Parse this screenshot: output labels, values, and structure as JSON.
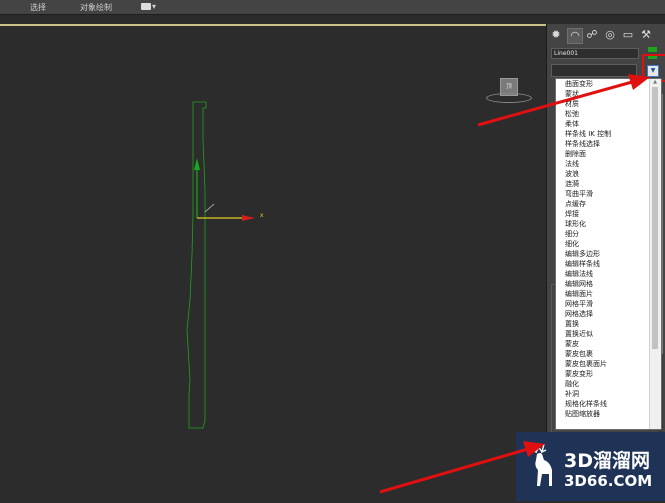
{
  "menubar": {
    "items": [
      "选择",
      "对象绘制"
    ],
    "dropdown_arrow": "▾"
  },
  "viewport": {
    "viewcube_face": "顶",
    "axis_x_label": "x"
  },
  "command_panel": {
    "tabs": [
      "create-icon",
      "modify-icon",
      "hierarchy-icon",
      "motion-icon",
      "display-icon",
      "utilities-icon"
    ],
    "tab_glyphs": [
      "✹",
      "◠",
      "☍",
      "◎",
      "▭",
      "⚒"
    ],
    "object_name": "Line001",
    "object_color": "#1ea51e",
    "dropdown_button_glyph": "▼"
  },
  "modifier_list": {
    "items": [
      "曲面变形",
      "蒙状",
      "材质",
      "松弛",
      "柔体",
      "样条线 IK 控制",
      "样条线选择",
      "删除面",
      "法线",
      "波浪",
      "涟漪",
      "弯曲平滑",
      "点缓存",
      "焊接",
      "球形化",
      "细分",
      "细化",
      "编辑多边形",
      "编辑样条线",
      "编辑法线",
      "编辑网格",
      "编辑面片",
      "网格平滑",
      "网格选择",
      "置换",
      "置换近似",
      "蒙皮",
      "蒙皮包裹",
      "蒙皮包裹面片",
      "蒙皮变形",
      "融化",
      "补洞",
      "规格化样条线",
      "贴图缩放器"
    ]
  },
  "watermark": {
    "cn": "3D溜溜网",
    "en": "3D66.COM"
  },
  "annotation_color": "#e01010"
}
